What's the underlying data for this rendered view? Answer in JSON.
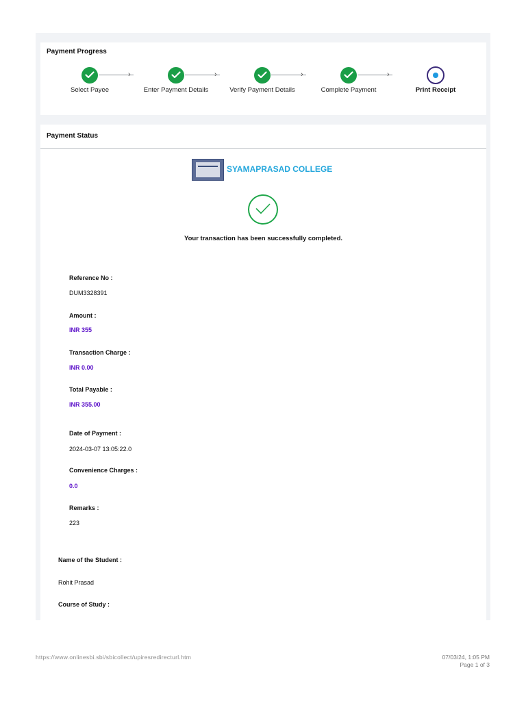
{
  "progress": {
    "title": "Payment Progress",
    "steps": [
      {
        "label": "Select Payee",
        "state": "done"
      },
      {
        "label": "Enter Payment Details",
        "state": "done"
      },
      {
        "label": "Verify Payment Details",
        "state": "done"
      },
      {
        "label": "Complete Payment",
        "state": "done"
      },
      {
        "label": "Print Receipt",
        "state": "current"
      }
    ]
  },
  "status": {
    "title": "Payment Status",
    "college_name": "SYAMAPRASAD COLLEGE",
    "college_logo": "college-emblem",
    "success_icon": "check-circle-icon",
    "message": "Your transaction has been successfully completed."
  },
  "fields": {
    "reference_no": {
      "label": "Reference No :",
      "value": "DUM3328391"
    },
    "amount": {
      "label": "Amount :",
      "value": "INR 355"
    },
    "transaction_charge": {
      "label": "Transaction Charge :",
      "value": "INR 0.00"
    },
    "total_payable": {
      "label": "Total Payable :",
      "value": "INR 355.00"
    },
    "date_of_payment": {
      "label": "Date of Payment :",
      "value": "2024-03-07 13:05:22.0"
    },
    "convenience_charges": {
      "label": "Convenience Charges :",
      "value": "0.0"
    },
    "remarks": {
      "label": "Remarks :",
      "value": "223"
    },
    "student_name": {
      "label": "Name of the Student :",
      "value": "Rohit Prasad"
    },
    "course_of_study": {
      "label": "Course of Study :",
      "value": ""
    }
  },
  "footer": {
    "url": "https://www.onlinesbi.sbi/sbicollect/upiresredirecturl.htm",
    "datetime": "07/03/24, 1:05 PM",
    "page": "Page 1 of 3"
  },
  "colors": {
    "done": "#1a9e47",
    "current_ring": "#3b2a7a",
    "current_dot": "#1e9ae0",
    "college": "#25a7dc",
    "money": "#5b10c9"
  }
}
